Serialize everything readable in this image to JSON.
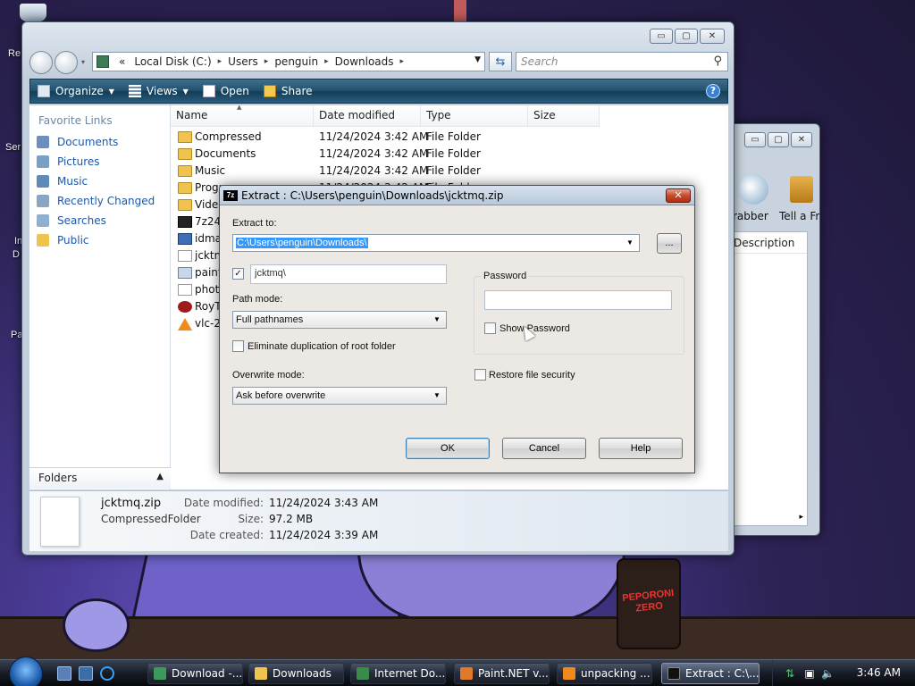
{
  "desktop": {
    "icons": [
      "Re",
      "Ser",
      "In",
      "D",
      "Pa"
    ],
    "can_label": "PEPORONI ZERO"
  },
  "explorer": {
    "caption": {
      "minimize": "▭",
      "maximize": "▢",
      "close": "✕"
    },
    "breadcrumb": [
      "«",
      "Local Disk (C:)",
      "Users",
      "penguin",
      "Downloads"
    ],
    "search_placeholder": "Search",
    "commands": [
      {
        "label": "Organize",
        "dropdown": true
      },
      {
        "label": "Views",
        "dropdown": true
      },
      {
        "label": "Open",
        "dropdown": false
      },
      {
        "label": "Share",
        "dropdown": false
      }
    ],
    "favorites_title": "Favorite Links",
    "favorites": [
      "Documents",
      "Pictures",
      "Music",
      "Recently Changed",
      "Searches",
      "Public"
    ],
    "folders_label": "Folders",
    "columns": [
      "Name",
      "Date modified",
      "Type",
      "Size"
    ],
    "files": [
      {
        "name": "Compressed",
        "date": "11/24/2024 3:42 AM",
        "type": "File Folder"
      },
      {
        "name": "Documents",
        "date": "11/24/2024 3:42 AM",
        "type": "File Folder"
      },
      {
        "name": "Music",
        "date": "11/24/2024 3:42 AM",
        "type": "File Folder"
      },
      {
        "name": "Progr",
        "date": "11/24/2024 3:42 AM",
        "type": "File Folder"
      },
      {
        "name": "Video",
        "date": "",
        "type": ""
      },
      {
        "name": "7z240",
        "date": "",
        "type": ""
      },
      {
        "name": "idma",
        "date": "",
        "type": ""
      },
      {
        "name": "jcktm",
        "date": "",
        "type": ""
      },
      {
        "name": "paint",
        "date": "",
        "type": ""
      },
      {
        "name": "photo",
        "date": "",
        "type": ""
      },
      {
        "name": "RoyT",
        "date": "",
        "type": ""
      },
      {
        "name": "vlc-2.",
        "date": "",
        "type": ""
      }
    ],
    "details": {
      "name": "jcktmq.zip",
      "type": "CompressedFolder",
      "date_modified_label": "Date modified:",
      "date_modified": "11/24/2024 3:43 AM",
      "size_label": "Size:",
      "size": "97.2 MB",
      "date_created_label": "Date created:",
      "date_created": "11/24/2024 3:39 AM"
    }
  },
  "second_window": {
    "tools": [
      "rabber",
      "Tell a Fr"
    ],
    "column": "Description"
  },
  "dialog": {
    "title": "Extract : C:\\Users\\penguin\\Downloads\\jcktmq.zip",
    "extract_to_label": "Extract to:",
    "extract_to_value": "C:\\Users\\penguin\\Downloads\\",
    "browse_label": "...",
    "subfolder_checked": true,
    "subfolder_value": "jcktmq\\",
    "path_mode_label": "Path mode:",
    "path_mode_value": "Full pathnames",
    "eliminate_label": "Eliminate duplication of root folder",
    "overwrite_label": "Overwrite mode:",
    "overwrite_value": "Ask before overwrite",
    "password_group": "Password",
    "password_value": "",
    "show_password_label": "Show Password",
    "restore_security_label": "Restore file security",
    "ok": "OK",
    "cancel": "Cancel",
    "help": "Help"
  },
  "taskbar": {
    "tasks": [
      {
        "label": "Download -...",
        "active": false
      },
      {
        "label": "Downloads",
        "active": false
      },
      {
        "label": "Internet Do...",
        "active": false
      },
      {
        "label": "Paint.NET v...",
        "active": false
      },
      {
        "label": "unpacking ...",
        "active": false
      },
      {
        "label": "Extract : C:\\...",
        "active": true
      }
    ],
    "clock": "3:46 AM"
  }
}
